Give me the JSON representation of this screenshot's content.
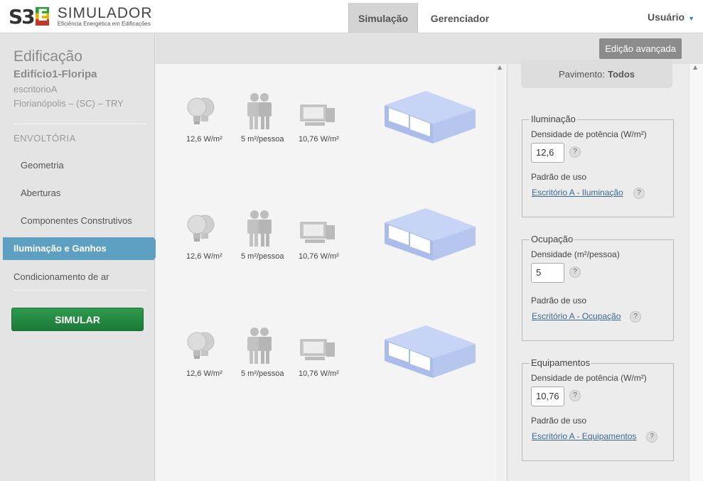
{
  "header": {
    "logo_mark": "S3E",
    "logo_title": "SIMULADOR",
    "logo_subtitle": "Eficiência Energética em Edificações",
    "tabs": [
      {
        "label": "Simulação",
        "active": true
      },
      {
        "label": "Gerenciador",
        "active": false
      }
    ],
    "user_label": "Usuário"
  },
  "sidebar": {
    "title": "Edificação",
    "building_name": "Edifício1-Floripa",
    "building_type": "escritorioA",
    "location": "Florianópolis – (SC) – TRY",
    "section": "ENVOLTÓRIA",
    "items": [
      "Geometria",
      "Aberturas",
      "Componentes Construtivos"
    ],
    "active_item": "Iluminação e Ganhos",
    "other_item": "Condicionamento de ar",
    "simulate_label": "SIMULAR"
  },
  "toolbar": {
    "advanced_label": "Edição avançada"
  },
  "floors": [
    {
      "lighting": "12,6 W/m²",
      "occupancy": "5 m²/pessoa",
      "equipment": "10,76 W/m²"
    },
    {
      "lighting": "12,6 W/m²",
      "occupancy": "5 m²/pessoa",
      "equipment": "10,76 W/m²"
    },
    {
      "lighting": "12,6 W/m²",
      "occupancy": "5 m²/pessoa",
      "equipment": "10,76 W/m²"
    }
  ],
  "panel": {
    "floor_label": "Pavimento:",
    "floor_value": "Todos",
    "lighting": {
      "legend": "Iluminação",
      "density_label": "Densidade de potência (W/m²)",
      "density_value": "12,6",
      "usage_label": "Padrão de uso",
      "usage_link": "Escritório A - Iluminação"
    },
    "occupancy": {
      "legend": "Ocupação",
      "density_label": "Densidade (m²/pessoa)",
      "density_value": "5",
      "usage_label": "Padrão de uso",
      "usage_link": "Escritório A - Ocupação"
    },
    "equipment": {
      "legend": "Equipamentos",
      "density_label": "Densidade de potência (W/m²)",
      "density_value": "10,76",
      "usage_label": "Padrão de uso",
      "usage_link": "Escritório A - Equipamentos"
    },
    "help_glyph": "?"
  },
  "colors": {
    "active_nav": "#5da0c2",
    "simulate_button": "#228a40",
    "building_block": "#b8c8f0"
  }
}
